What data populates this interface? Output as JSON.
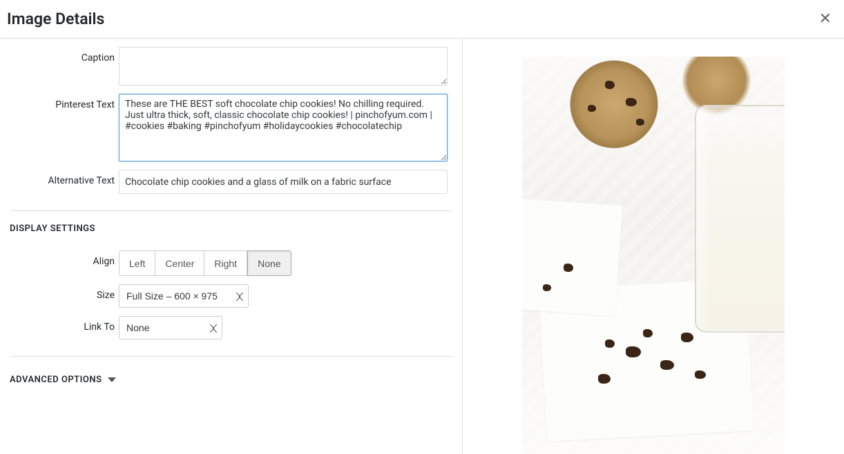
{
  "modal": {
    "title": "Image Details"
  },
  "fields": {
    "caption_label": "Caption",
    "caption_value": "",
    "pinterest_label": "Pinterest Text",
    "pinterest_value": "These are THE BEST soft chocolate chip cookies! No chilling required. Just ultra thick, soft, classic chocolate chip cookies! | pinchofyum.com | #cookies #baking #pinchofyum #holidaycookies #chocolatechip",
    "alt_label": "Alternative Text",
    "alt_value": "Chocolate chip cookies and a glass of milk on a fabric surface"
  },
  "display": {
    "heading": "DISPLAY SETTINGS",
    "align_label": "Align",
    "align_options": {
      "left": "Left",
      "center": "Center",
      "right": "Right",
      "none": "None"
    },
    "align_selected": "none",
    "size_label": "Size",
    "size_value": "Full Size – 600 × 975",
    "link_label": "Link To",
    "link_value": "None"
  },
  "advanced": {
    "heading": "ADVANCED OPTIONS"
  }
}
